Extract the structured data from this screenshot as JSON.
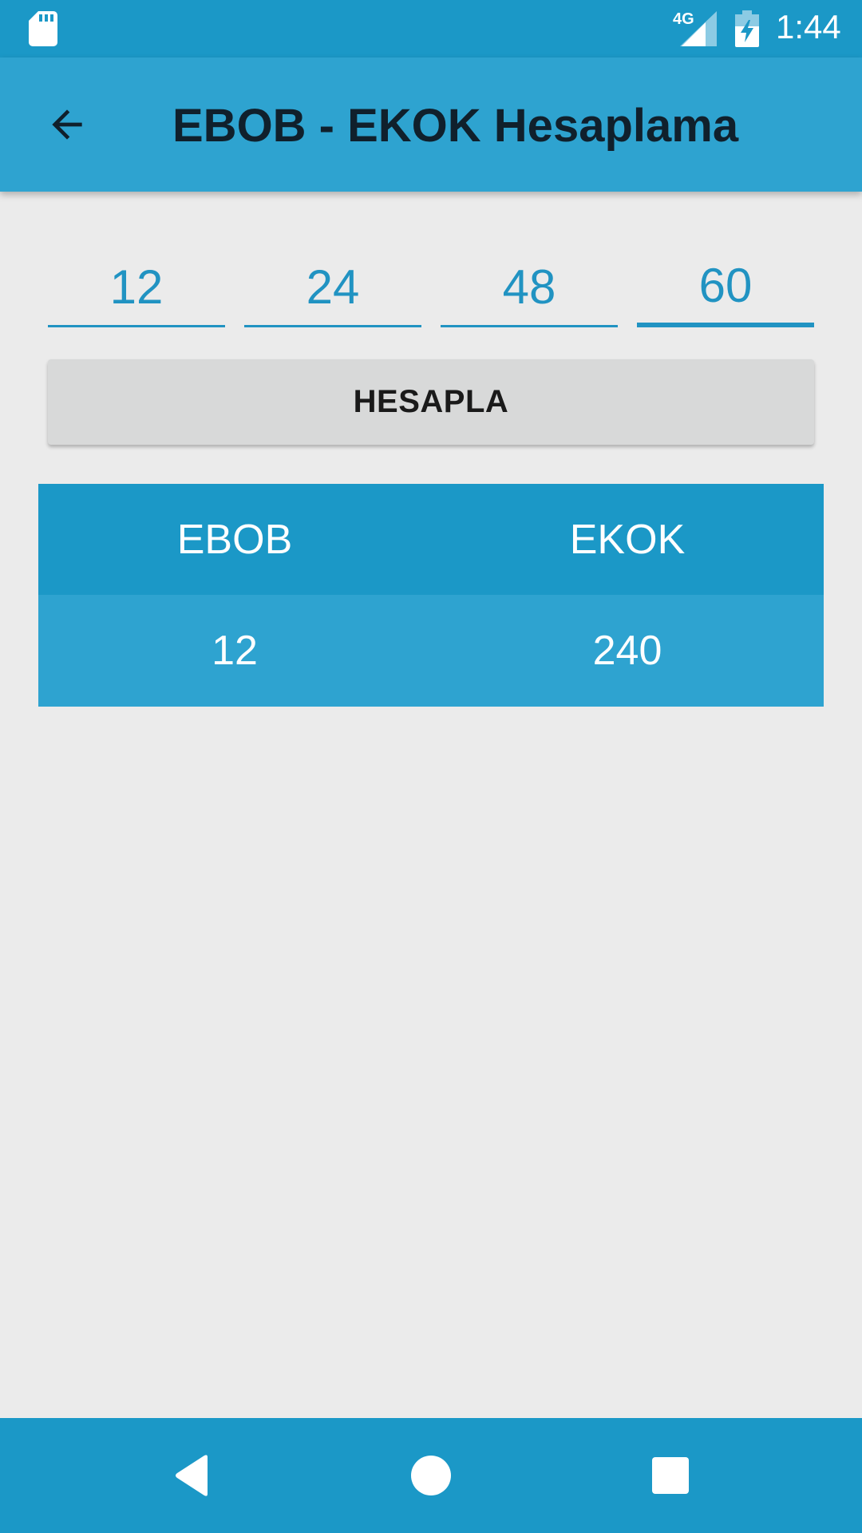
{
  "status_bar": {
    "network": "4G",
    "time": "1:44",
    "icons": [
      "sd-card-icon",
      "signal-icon",
      "battery-charging-icon"
    ]
  },
  "app_bar": {
    "title": "EBOB - EKOK Hesaplama",
    "back_icon": "arrow-left-icon"
  },
  "inputs": [
    {
      "value": "12"
    },
    {
      "value": "24"
    },
    {
      "value": "48"
    },
    {
      "value": "60"
    }
  ],
  "calculate_button": {
    "label": "HESAPLA"
  },
  "results": {
    "headers": [
      "EBOB",
      "EKOK"
    ],
    "values": [
      "12",
      "240"
    ]
  },
  "nav_bar": {
    "icons": [
      "nav-back-icon",
      "nav-home-icon",
      "nav-recents-icon"
    ]
  },
  "colors": {
    "primary_dark": "#1B98C7",
    "primary": "#2EA3D0",
    "accent_text": "#2193C2",
    "background": "#EBEBEB",
    "button": "#D8D9D9"
  }
}
